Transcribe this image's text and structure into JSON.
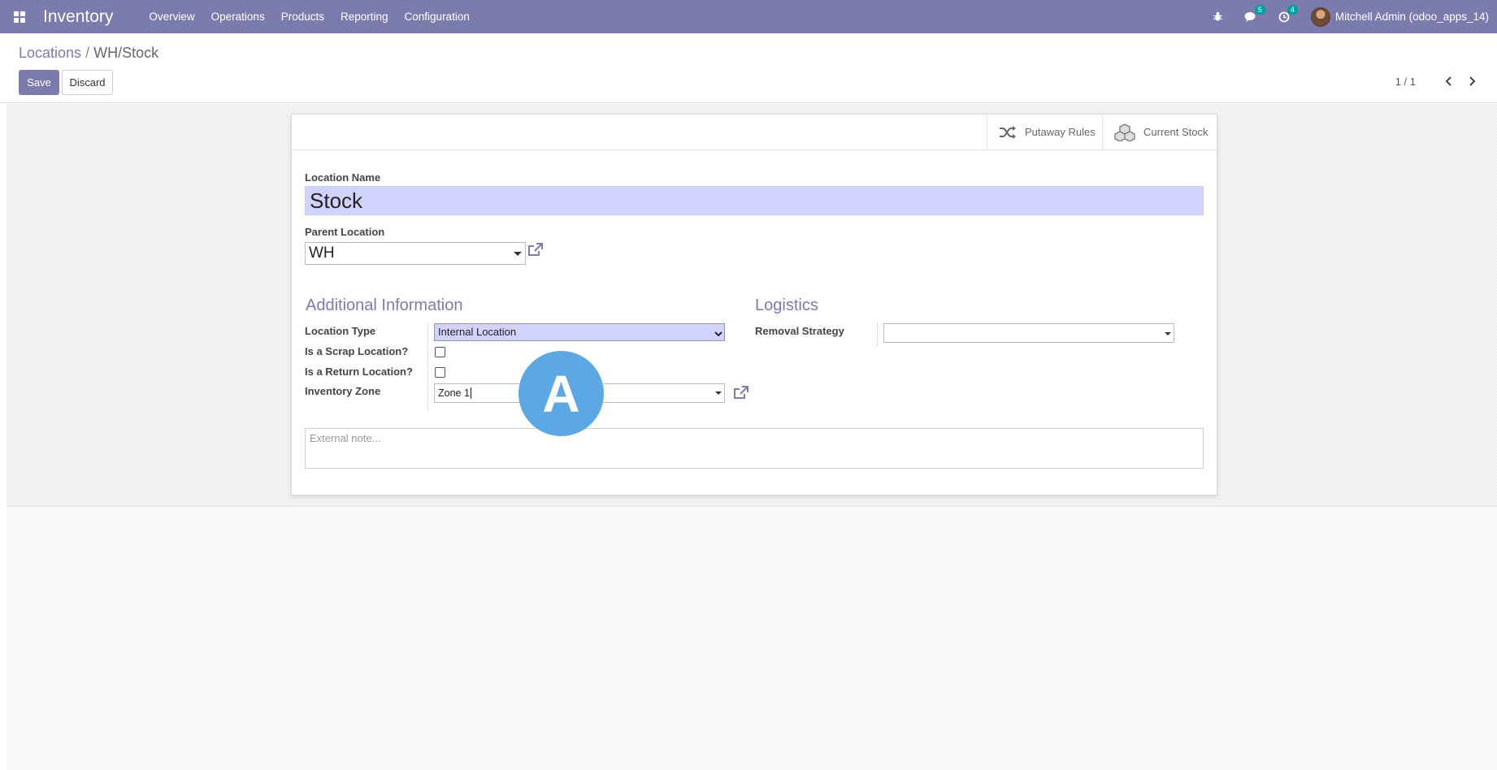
{
  "navbar": {
    "app_name": "Inventory",
    "menu": [
      "Overview",
      "Operations",
      "Products",
      "Reporting",
      "Configuration"
    ],
    "messages_count": "5",
    "activities_count": "4",
    "user": "Mitchell Admin (odoo_apps_14)",
    "colors": {
      "navbar": "#7c7bad",
      "badge": "#00a09d"
    },
    "icons": [
      "apps-icon",
      "bug-icon",
      "chat-icon",
      "clock-icon"
    ]
  },
  "control_panel": {
    "breadcrumb": {
      "parent": "Locations",
      "separator": "/",
      "current": "WH/Stock"
    },
    "save_label": "Save",
    "discard_label": "Discard",
    "pager": "1 / 1"
  },
  "smart_buttons": {
    "putaway": "Putaway Rules",
    "stock": "Current Stock"
  },
  "form": {
    "name_label": "Location Name",
    "name_value": "Stock",
    "parent_label": "Parent Location",
    "parent_value": "WH",
    "additional_title": "Additional Information",
    "logistics_title": "Logistics",
    "location_type_label": "Location Type",
    "location_type_value": "Internal Location",
    "scrap_label": "Is a Scrap Location?",
    "scrap_checked": false,
    "return_label": "Is a Return Location?",
    "return_checked": false,
    "zone_label": "Inventory Zone",
    "zone_value": "Zone 1",
    "removal_label": "Removal Strategy",
    "removal_value": "",
    "note_placeholder": "External note..."
  },
  "overlay": {
    "marker": "A",
    "color": "#5ca8e4"
  }
}
